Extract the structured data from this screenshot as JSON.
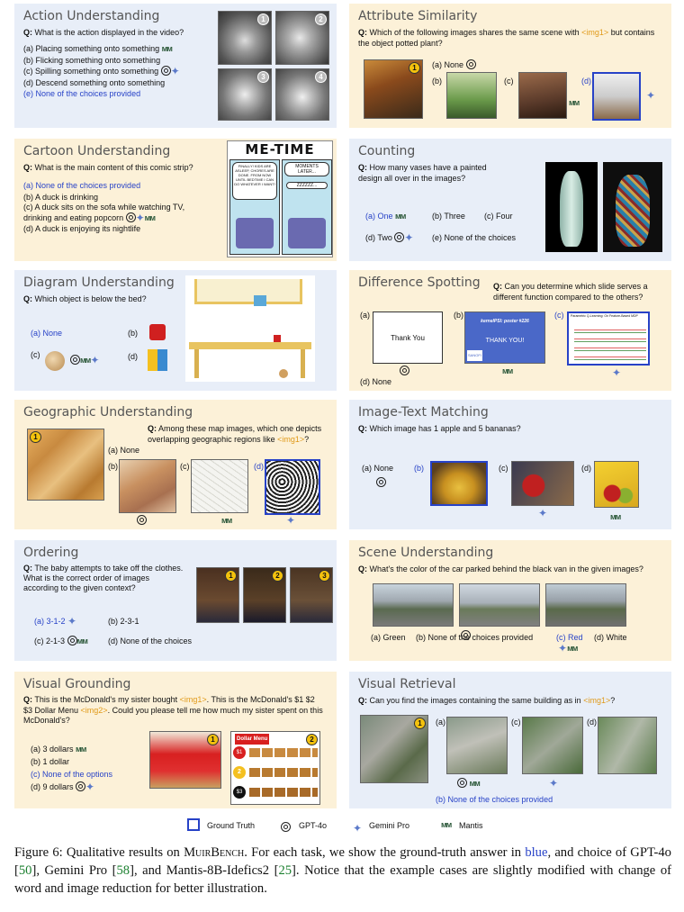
{
  "panels": {
    "action": {
      "title": "Action Understanding",
      "q_prefix": "Q:",
      "question": "What is the action displayed in the video?",
      "options": [
        "(a) Placing something onto something",
        "(b) Flicking something onto something",
        "(c) Spilling something onto something",
        "(d) Descend something onto something",
        "(e) None of the choices provided"
      ],
      "badges": [
        "1",
        "2",
        "3",
        "4"
      ]
    },
    "attribute": {
      "title": "Attribute Similarity",
      "q_prefix": "Q:",
      "question_a": "Which of the following images shares the same scene with",
      "question_tag": "<img1>",
      "question_b": "but contains the object potted plant?",
      "options": [
        "(a) None",
        "(b)",
        "(c)",
        "(d)"
      ],
      "badge": "1"
    },
    "cartoon": {
      "title": "Cartoon Understanding",
      "q_prefix": "Q:",
      "question": "What is the main content of this comic strip?",
      "options": [
        "(a) None of the choices provided",
        "(b) A duck is drinking",
        "(c) A duck sits on the sofa while watching TV, drinking and eating popcorn",
        "(d) A duck is enjoying its nightlife"
      ],
      "comic_title": "ME-TIME",
      "bubble1": "FINALLY! KIDS ARE ASLEEP, CHORES ARE DONE. FROM NOW UNTIL BEDTIME I CAN DO WHATEVER I WANT!",
      "bubble2": "MOMENTS LATER...",
      "bubble3": "ZZZZZZ..."
    },
    "counting": {
      "title": "Counting",
      "q_prefix": "Q:",
      "question": "How many vases have a painted design all over in the images?",
      "options": [
        "(a) One",
        "(b) Three",
        "(c) Four",
        "(d) Two",
        "(e) None of the choices"
      ]
    },
    "diagram": {
      "title": "Diagram Understanding",
      "q_prefix": "Q:",
      "question": "Which object is below the bed?",
      "options": [
        "(a) None",
        "(b)",
        "(c)",
        "(d)"
      ]
    },
    "difference": {
      "title": "Difference Spotting",
      "q_prefix": "Q:",
      "question": "Can you determine which slide serves a different function compared to the others?",
      "options": [
        "(a)",
        "(b)",
        "(c)",
        "(d) None"
      ],
      "slide_a": "Thank You",
      "slide_b_title": "kernelPSI: poster #226",
      "slide_b_body": "THANK YOU!",
      "slide_b_logo": "SANOFI",
      "slide_c_title": "Parametric Q-Learning: On Feature-Based MDP"
    },
    "geographic": {
      "title": "Geographic Understanding",
      "q_prefix": "Q:",
      "question_a": "Among these map images, which one depicts overlapping geographic regions like",
      "question_tag": "<img1>",
      "question_b": "?",
      "options": [
        "(a) None",
        "(b)",
        "(c)",
        "(d)"
      ],
      "badge": "1"
    },
    "imagetext": {
      "title": "Image-Text Matching",
      "q_prefix": "Q:",
      "question": "Which image has 1 apple and 5 bananas?",
      "options": [
        "(a) None",
        "(b)",
        "(c)",
        "(d)"
      ]
    },
    "ordering": {
      "title": "Ordering",
      "q_prefix": "Q:",
      "question": "The baby attempts to take off the clothes. What is the correct order of images according to the given context?",
      "options": [
        "(a) 3-1-2",
        "(b) 2-3-1",
        "(c) 2-1-3",
        "(d) None of the choices"
      ],
      "badges": [
        "1",
        "2",
        "3"
      ]
    },
    "scene": {
      "title": "Scene Understanding",
      "q_prefix": "Q:",
      "question": "What's the color of the car parked behind the black van in the given images?",
      "options": [
        "(a) Green",
        "(b) None of the choices provided",
        "(c) Red",
        "(d) White"
      ]
    },
    "visualgrounding": {
      "title": "Visual Grounding",
      "q_prefix": "Q:",
      "question_a": "This is the McDonald's my sister bought",
      "tag1": "<img1>",
      "question_b": ". This is the McDonald's $1 $2 $3 Dollar Menu",
      "tag2": "<img2>",
      "question_c": ". Could you please tell me how much my sister spent on this McDonald's?",
      "options": [
        "(a) 3 dollars",
        "(b) 1 dollar",
        "(c) None of the options",
        "(d) 9 dollars"
      ],
      "menu_title": "Dollar Menu",
      "menu_prices": [
        "$1",
        "2",
        "$3"
      ],
      "badges": [
        "1",
        "2"
      ]
    },
    "retrieval": {
      "title": "Visual Retrieval",
      "q_prefix": "Q:",
      "question_a": "Can you find the images containing the same building as in",
      "question_tag": "<img1>",
      "question_b": "?",
      "options": [
        "(a)",
        "(b)",
        "(c)",
        "(d)"
      ],
      "answer": "(b) None of the choices provided",
      "badge": "1"
    }
  },
  "legend": {
    "ground_truth": "Ground Truth",
    "gpt": "GPT-4o",
    "gemini": "Gemini Pro",
    "mantis": "Mantis"
  },
  "caption": {
    "fig": "Figure 6:",
    "t1": " Qualitative results on ",
    "bench": "MuirBench",
    "t2": ". For each task, we show the ground-truth answer in ",
    "blue": "blue",
    "t3": ", and choice of GPT-4o [",
    "r1": "50",
    "t4": "], Gemini Pro [",
    "r2": "58",
    "t5": "], and Mantis-8B-Idefics2 [",
    "r3": "25",
    "t6": "]. Notice that the example cases are slightly modified with change of word and image reduction for better illustration."
  },
  "colors": {
    "blue_panel": "#e8eef8",
    "yellow_panel": "#fcf1d8",
    "ground_truth": "#2742c7",
    "tag": "#e09a1a"
  }
}
